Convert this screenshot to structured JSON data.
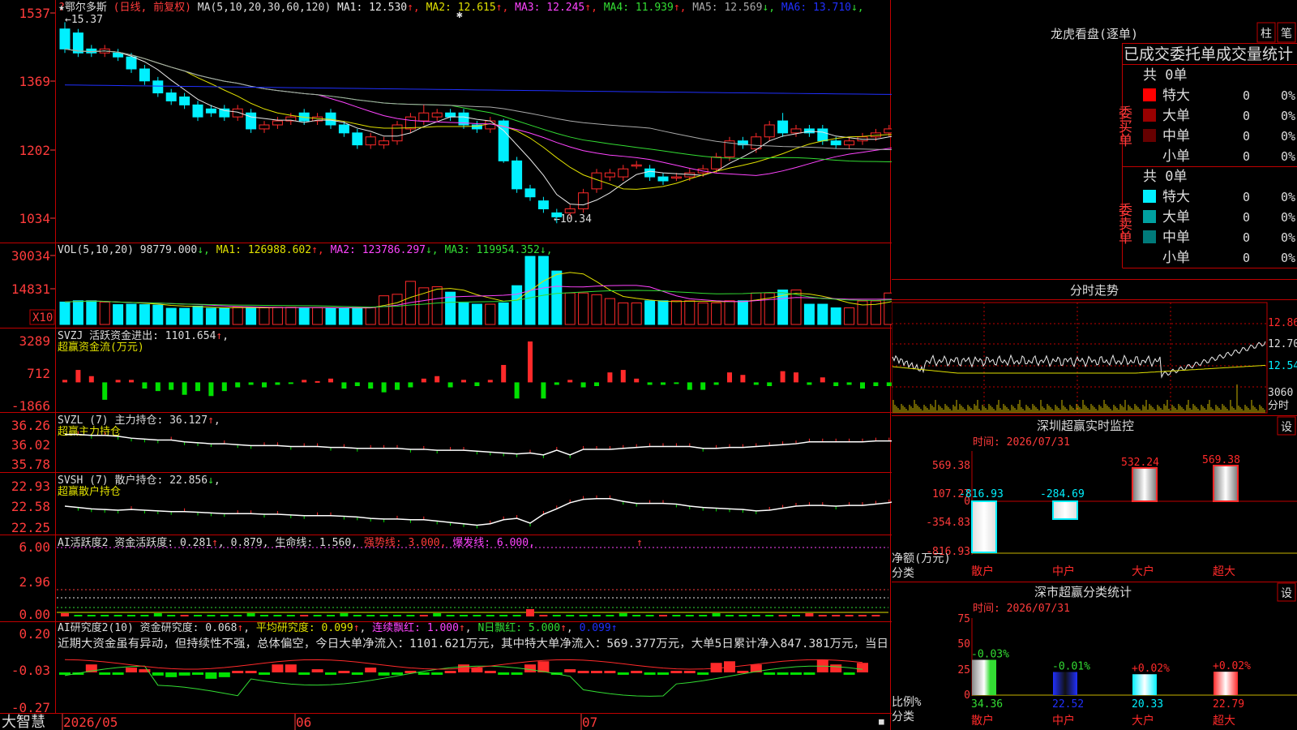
{
  "app": {
    "name": "大智慧",
    "stock_name": "★鄂尔多斯",
    "mode": "(日线, 前复权)"
  },
  "colors": {
    "up": "#ff2a2a",
    "down": "#00f0ff",
    "grid": "#c00000",
    "ma1": "#e8e8e8",
    "ma2": "#e0e000",
    "ma3": "#ff44ff",
    "ma4": "#33dd33",
    "ma5": "#aaaaaa",
    "ma6": "#2030ff"
  },
  "kline": {
    "params": "MA(5,10,20,30,60,120)",
    "ma": [
      {
        "label": "MA1: 12.530",
        "arrow": "↑",
        "color": "#e8e8e8"
      },
      {
        "label": "MA2: 12.615",
        "arrow": "↑",
        "color": "#e0e000"
      },
      {
        "label": "MA3: 12.245",
        "arrow": "↑",
        "color": "#ff44ff"
      },
      {
        "label": "MA4: 11.939",
        "arrow": "↑",
        "color": "#33dd33"
      },
      {
        "label": "MA5: 12.569",
        "arrow": "↓",
        "color": "#aaaaaa"
      },
      {
        "label": "MA6: 13.710",
        "arrow": "↓",
        "color": "#2030ff"
      }
    ],
    "y_labels": [
      "1537",
      "1369",
      "1202",
      "1034"
    ],
    "high_label": "15.37",
    "low_label": "←10.34",
    "ylim": [
      10.0,
      15.6
    ],
    "candles": [
      [
        15.2,
        14.7,
        15.37,
        14.6
      ],
      [
        15.1,
        14.6,
        15.2,
        14.5
      ],
      [
        14.7,
        14.6,
        14.8,
        14.5
      ],
      [
        14.6,
        14.7,
        14.8,
        14.5
      ],
      [
        14.6,
        14.5,
        14.7,
        14.4
      ],
      [
        14.5,
        14.2,
        14.6,
        14.1
      ],
      [
        14.2,
        13.9,
        14.3,
        13.8
      ],
      [
        13.9,
        13.6,
        14.0,
        13.5
      ],
      [
        13.6,
        13.4,
        13.7,
        13.3
      ],
      [
        13.5,
        13.3,
        13.6,
        13.2
      ],
      [
        13.3,
        13.0,
        13.4,
        12.9
      ],
      [
        13.2,
        13.1,
        13.3,
        13.0
      ],
      [
        13.2,
        13.0,
        13.3,
        12.9
      ],
      [
        13.0,
        13.2,
        13.3,
        12.9
      ],
      [
        13.1,
        12.7,
        13.2,
        12.6
      ],
      [
        12.7,
        12.8,
        12.9,
        12.6
      ],
      [
        12.8,
        12.9,
        13.0,
        12.7
      ],
      [
        12.9,
        13.0,
        13.1,
        12.8
      ],
      [
        13.1,
        12.9,
        13.2,
        12.8
      ],
      [
        12.9,
        13.0,
        13.1,
        12.8
      ],
      [
        13.1,
        12.8,
        13.2,
        12.7
      ],
      [
        12.8,
        12.6,
        12.9,
        12.5
      ],
      [
        12.6,
        12.3,
        12.7,
        12.2
      ],
      [
        12.3,
        12.5,
        12.6,
        12.2
      ],
      [
        12.3,
        12.4,
        12.5,
        12.2
      ],
      [
        12.4,
        12.8,
        12.9,
        12.3
      ],
      [
        12.7,
        13.0,
        13.1,
        12.6
      ],
      [
        12.9,
        13.1,
        13.3,
        12.8
      ],
      [
        13.0,
        13.1,
        13.2,
        12.9
      ],
      [
        13.1,
        13.0,
        13.2,
        12.9
      ],
      [
        13.1,
        12.8,
        13.2,
        12.7
      ],
      [
        12.8,
        12.7,
        12.9,
        12.6
      ],
      [
        12.7,
        12.9,
        13.0,
        12.6
      ],
      [
        12.9,
        11.9,
        12.95,
        11.85
      ],
      [
        11.9,
        11.2,
        12.0,
        11.1
      ],
      [
        11.2,
        11.0,
        11.3,
        10.9
      ],
      [
        10.9,
        10.7,
        11.0,
        10.6
      ],
      [
        10.6,
        10.5,
        10.7,
        10.34
      ],
      [
        10.6,
        10.7,
        10.8,
        10.5
      ],
      [
        10.7,
        11.1,
        11.2,
        10.6
      ],
      [
        11.2,
        11.6,
        11.7,
        11.1
      ],
      [
        11.5,
        11.6,
        11.7,
        11.4
      ],
      [
        11.5,
        11.7,
        11.8,
        11.4
      ],
      [
        11.8,
        11.8,
        11.9,
        11.7
      ],
      [
        11.7,
        11.5,
        11.8,
        11.4
      ],
      [
        11.5,
        11.4,
        11.6,
        11.3
      ],
      [
        11.5,
        11.5,
        11.6,
        11.4
      ],
      [
        11.5,
        11.6,
        11.7,
        11.4
      ],
      [
        11.6,
        11.7,
        11.8,
        11.5
      ],
      [
        11.7,
        12.0,
        12.1,
        11.6
      ],
      [
        12.0,
        12.4,
        12.5,
        11.9
      ],
      [
        12.4,
        12.3,
        12.5,
        12.2
      ],
      [
        12.2,
        12.5,
        12.6,
        12.1
      ],
      [
        12.5,
        12.8,
        12.9,
        12.4
      ],
      [
        12.9,
        12.6,
        13.1,
        12.5
      ],
      [
        12.6,
        12.7,
        12.8,
        12.5
      ],
      [
        12.7,
        12.6,
        12.8,
        12.5
      ],
      [
        12.7,
        12.4,
        12.8,
        12.3
      ],
      [
        12.4,
        12.3,
        12.5,
        12.2
      ],
      [
        12.3,
        12.4,
        12.5,
        12.2
      ],
      [
        12.4,
        12.5,
        12.6,
        12.3
      ],
      [
        12.5,
        12.6,
        12.7,
        12.4
      ],
      [
        12.6,
        12.7,
        12.8,
        12.5
      ],
      [
        12.5,
        12.6,
        12.7,
        12.4
      ]
    ]
  },
  "vol": {
    "header": "VOL(5,10,20)",
    "value": "98779.000",
    "ma": [
      {
        "label": "MA1: 126988.602",
        "arrow": "↑",
        "color": "#e0e000"
      },
      {
        "label": "MA2: 123786.297",
        "arrow": "↓",
        "color": "#ff44ff"
      },
      {
        "label": "MA3: 119954.352",
        "arrow": "↓",
        "color": "#33dd33"
      }
    ],
    "y_labels": [
      "30034",
      "14831"
    ],
    "unit_badge": "X10",
    "ylim": [
      0,
      32000
    ],
    "bars": [
      10400,
      11000,
      11000,
      10400,
      9200,
      9400,
      9200,
      9000,
      7500,
      7500,
      8500,
      7500,
      7500,
      8000,
      7800,
      7800,
      8000,
      8000,
      7800,
      7800,
      7500,
      7500,
      7800,
      7800,
      13300,
      14000,
      20000,
      17000,
      17500,
      15000,
      10000,
      9400,
      9400,
      10000,
      18000,
      31600,
      31600,
      24800,
      14600,
      14600,
      13800,
      12000,
      10000,
      10000,
      11000,
      11000,
      11000,
      11000,
      10000,
      10000,
      11000,
      11000,
      14600,
      14600,
      16000,
      16000,
      9400,
      9400,
      7700,
      7700,
      10900,
      10900,
      14600,
      14600,
      14000,
      14000,
      12000,
      10500
    ]
  },
  "svzj": {
    "header": "SVZJ  活跃资金进出: 1101.654",
    "arrow": "↑",
    "sub_title": "超赢资金流(万元)",
    "y_labels": [
      "3289",
      "712",
      "-1866"
    ],
    "ylim": [
      -1866,
      3289
    ],
    "values": [
      200,
      1000,
      500,
      -1400,
      200,
      200,
      -500,
      -700,
      -600,
      -1000,
      -700,
      -1100,
      -700,
      -400,
      -200,
      -400,
      -200,
      -100,
      200,
      100,
      300,
      -500,
      -300,
      -500,
      -800,
      -600,
      -400,
      300,
      500,
      -400,
      200,
      -300,
      200,
      1400,
      -1300,
      3289,
      -1300,
      -200,
      200,
      -400,
      -300,
      800,
      1000,
      300,
      -200,
      -200,
      -100,
      -600,
      -600,
      -200,
      800,
      600,
      -200,
      -300,
      900,
      800,
      -200,
      400,
      -300,
      -200,
      -500,
      -300,
      -300,
      400,
      1000
    ]
  },
  "svzl": {
    "header": "SVZL (7) 主力持仓: 36.127",
    "arrow": "↑",
    "sub_title": "超赢主力持仓",
    "y_labels": [
      "36.26",
      "36.02",
      "35.78"
    ],
    "ylim": [
      35.78,
      36.26
    ],
    "values": [
      36.15,
      36.15,
      36.14,
      36.14,
      36.13,
      36.11,
      36.1,
      36.09,
      36.09,
      36.07,
      36.06,
      36.05,
      36.05,
      36.04,
      36.03,
      36.03,
      36.03,
      36.02,
      36.02,
      36.02,
      36.01,
      36.01,
      36.0,
      36.0,
      36.0,
      36.0,
      35.99,
      35.99,
      35.98,
      35.98,
      35.98,
      35.97,
      35.96,
      35.95,
      35.94,
      35.95,
      35.93,
      35.98,
      35.93,
      35.99,
      35.99,
      35.99,
      36.0,
      36.01,
      36.02,
      36.02,
      36.02,
      36.02,
      36.0,
      36.0,
      36.01,
      36.01,
      36.02,
      36.03,
      36.04,
      36.05,
      36.07,
      36.07,
      36.07,
      36.07,
      36.07,
      36.08,
      36.08,
      36.08,
      36.08,
      36.1,
      36.13
    ]
  },
  "svsh": {
    "header": "SVSH (7) 散户持仓: 22.856",
    "arrow": "↓",
    "sub_title": "超赢散户持仓",
    "y_labels": [
      "22.93",
      "22.58",
      "22.25"
    ],
    "ylim": [
      22.25,
      22.93
    ],
    "values": [
      22.62,
      22.6,
      22.58,
      22.57,
      22.56,
      22.57,
      22.56,
      22.55,
      22.54,
      22.54,
      22.53,
      22.52,
      22.51,
      22.51,
      22.51,
      22.5,
      22.5,
      22.49,
      22.48,
      22.48,
      22.48,
      22.47,
      22.46,
      22.44,
      22.43,
      22.43,
      22.42,
      22.42,
      22.4,
      22.38,
      22.36,
      22.34,
      22.36,
      22.42,
      22.44,
      22.37,
      22.5,
      22.58,
      22.67,
      22.72,
      22.73,
      22.73,
      22.69,
      22.66,
      22.66,
      22.66,
      22.65,
      22.62,
      22.6,
      22.59,
      22.58,
      22.57,
      22.55,
      22.56,
      22.59,
      22.62,
      22.63,
      22.63,
      22.62,
      22.63,
      22.63,
      22.65,
      22.67,
      22.72,
      22.78,
      22.82,
      22.86,
      22.83
    ]
  },
  "ai1": {
    "header": "AI活跃度2 资金活跃度: 0.281",
    "arrow1": "↑",
    "v2": ", 0.879, 生命线: 1.560,",
    "strong": "强势线: 3.000,",
    "burst": "爆发线: 6.000,",
    "arrow_mark": "↑",
    "y_labels": [
      "6.00",
      "2.96",
      "0.00"
    ],
    "ylim": [
      0,
      6.5
    ]
  },
  "ai2": {
    "header": "AI研究度2(10) 资金研究度: 0.068",
    "arrow1": "↑",
    "avg": "平均研究度: 0.099",
    "streak": "连续飘红: 1.000",
    "nday": "N日飘红: 5.000",
    "last": "0.099",
    "comment": "近期大资金虽有异动，但持续性不强，总体偏空，今日大单净流入：1101.621万元，其中特大单净流入：569.377万元，大单5日累计净入847.381万元，当日",
    "y_labels": [
      "0.20",
      "-0.03",
      "-0.27"
    ],
    "ylim": [
      -0.27,
      0.22
    ],
    "values": [
      -0.03,
      -0.03,
      0.02,
      -0.03,
      -0.03,
      0.0,
      -0.01,
      -0.05,
      -0.06,
      -0.05,
      -0.04,
      -0.07,
      -0.06,
      -0.02,
      -0.02,
      -0.03,
      0.02,
      0.02,
      -0.04,
      -0.01,
      -0.03,
      -0.02,
      -0.03,
      0.0,
      -0.05,
      -0.03,
      -0.02,
      -0.04,
      -0.04,
      -0.02,
      0.02,
      0.0,
      -0.02,
      -0.04,
      -0.03,
      0.02,
      0.04,
      -0.03,
      -0.01,
      -0.02,
      -0.02,
      -0.02,
      -0.03,
      -0.02,
      -0.03,
      -0.03,
      -0.02,
      -0.02,
      -0.03,
      0.03,
      0.04,
      -0.02,
      0.02,
      -0.04,
      -0.03,
      -0.03,
      -0.04,
      0.05,
      0.02,
      -0.03,
      0.03
    ]
  },
  "xaxis": {
    "labels": [
      "2026/05",
      "06",
      "07"
    ]
  },
  "right": {
    "dragon_title": "龙虎看盘(逐单)",
    "btn_col": "柱",
    "btn_stroke": "笔",
    "stat_title": "已成交委托单成交量统计",
    "buy_label": "委买单",
    "sell_label": "委卖单",
    "buy_total": "共 0单",
    "sell_total": "共 0单",
    "buy_rows": [
      {
        "name": "特大",
        "value": "0",
        "pct": "0%",
        "color": "#ff0000"
      },
      {
        "name": "大单",
        "value": "0",
        "pct": "0%",
        "color": "#990000"
      },
      {
        "name": "中单",
        "value": "0",
        "pct": "0%",
        "color": "#660000"
      },
      {
        "name": "小单",
        "value": "0",
        "pct": "0%",
        "color": ""
      }
    ],
    "sell_rows": [
      {
        "name": "特大",
        "value": "0",
        "pct": "0%",
        "color": "#00f0ff"
      },
      {
        "name": "大单",
        "value": "0",
        "pct": "0%",
        "color": "#00a0a0"
      },
      {
        "name": "中单",
        "value": "0",
        "pct": "0%",
        "color": "#007a7a"
      },
      {
        "name": "小单",
        "value": "0",
        "pct": "0%",
        "color": ""
      }
    ],
    "intraday_title": "分时走势",
    "intraday_prices": [
      "12.86",
      "12.70",
      "12.54"
    ],
    "intraday_vol": "3060",
    "intraday_unit": "分时",
    "monitor_title": "深圳超赢实时监控",
    "setting_btn": "设",
    "monitor_time": "时间: 2026/07/31",
    "monitor_y": [
      "569.38",
      "107.27",
      "0",
      "-354.83",
      "-816.93"
    ],
    "monitor_ylabel": "净额(万元)",
    "monitor_xlabel": "分类",
    "monitor_categories": [
      "散户",
      "中户",
      "大户",
      "超大"
    ],
    "monitor_values": [
      -816.93,
      -284.69,
      532.24,
      569.38
    ],
    "monitor_value_labels": [
      "-816.93",
      "-284.69",
      "532.24",
      "569.38"
    ],
    "stat2_title": "深市超赢分类统计",
    "stat2_time": "时间: 2026/07/31",
    "stat2_y": [
      "75",
      "50",
      "25",
      "0"
    ],
    "stat2_ylabel": "比例%",
    "stat2_xlabel": "分类",
    "stat2_categories": [
      "散户",
      "中户",
      "大户",
      "超大"
    ],
    "stat2_values": [
      34.36,
      22.52,
      20.33,
      22.79
    ],
    "stat2_value_labels": [
      "34.36",
      "22.52",
      "20.33",
      "22.79"
    ],
    "stat2_change_labels": [
      "-0.03%",
      "-0.01%",
      "+0.02%",
      "+0.02%"
    ]
  }
}
